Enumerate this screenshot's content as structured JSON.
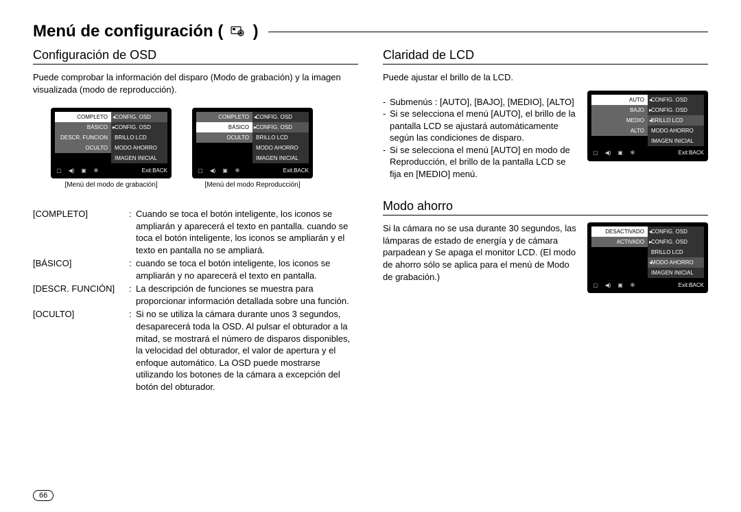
{
  "page_title_prefix": "Menú de configuración ( ",
  "page_title_suffix": " )",
  "page_number": "66",
  "left": {
    "section_title": "Configuración de OSD",
    "intro": "Puede comprobar la información del disparo (Modo de grabación) y la imagen visualizada (modo de reproducción).",
    "menu1_caption": "[Menú del modo de grabación]",
    "menu2_caption": "[Menú del modo Reproducción]",
    "defs": {
      "r0_label": "[COMPLETO]",
      "r0_desc": "Cuando se toca el botón inteligente, los iconos se ampliarán y aparecerá el texto en pantalla. cuando se toca el botón inteligente, los iconos se ampliarán y el texto en pantalla no se ampliará.",
      "r1_label": "[BÁSICO]",
      "r1_desc": "cuando se toca el botón inteligente, los iconos se ampliarán y no aparecerá el texto en pantalla.",
      "r2_label": "[DESCR. FUNCIÓN]",
      "r2_desc": "La descripción de funciones se muestra para proporcionar información detallada sobre una función.",
      "r3_label": "[OCULTO]",
      "r3_desc": "Si no se utiliza la cámara durante unos 3 segundos, desaparecerá toda la OSD. Al pulsar el obturador a la mitad, se mostrará el número de disparos disponibles, la velocidad del obturador, el valor de apertura y el enfoque automático. La OSD puede mostrarse utilizando los botones de la cámara a excepción del botón del obturador."
    }
  },
  "right": {
    "sec1_title": "Claridad de LCD",
    "sec1_intro": "Puede ajustar el brillo de la LCD.",
    "sec1_b0": "Submenús : [AUTO], [BAJO], [MEDIO], [ALTO]",
    "sec1_b1": "Si se selecciona el menú [AUTO], el brillo de la pantalla LCD se ajustará automáticamente según las condiciones de disparo.",
    "sec1_b2": "Si se selecciona el menú [AUTO] en modo de Reproducción, el brillo de la pantalla LCD se fija en [MEDIO] menú.",
    "sec2_title": "Modo ahorro",
    "sec2_text": "Si la cámara no se usa durante 30 segundos, las lámparas de estado de energía y de cámara parpadean y Se apaga el monitor LCD. (El modo de ahorro sólo se aplica para el menú de Modo de grabación.)"
  },
  "menus": {
    "osd_left": [
      "COMPLETO",
      "BÁSICO",
      "DESCR. FUNCION",
      "OCULTO"
    ],
    "osd_left2": [
      "COMPLETO",
      "BÁSICO",
      "OCULTO"
    ],
    "osd_right5_0": "CONFIG. OSD",
    "osd_right5_1": "CONFIG. OSD",
    "osd_right5_2": "BRILLO LCD",
    "osd_right5_3": "MODO AHORRO",
    "osd_right5_4": "IMAGEN INICIAL",
    "lcd_left": [
      "AUTO",
      "BAJO",
      "MEDIO",
      "ALTO"
    ],
    "ahorro_left": [
      "DESACTIVADO",
      "ACTIVADO"
    ],
    "footer_exit": "Exit:BACK"
  }
}
